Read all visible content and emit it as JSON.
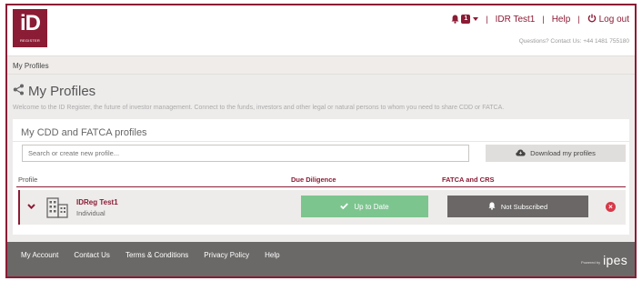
{
  "header": {
    "logo_text": "iD",
    "logo_sub": "REGISTER",
    "notification_count": "1",
    "user_name": "IDR Test1",
    "help_label": "Help",
    "logout_label": "Log out",
    "contact_text": "Questions? Contact Us: +44 1481 755180"
  },
  "breadcrumb": {
    "current": "My Profiles"
  },
  "page": {
    "title": "My Profiles",
    "welcome": "Welcome to the ID Register, the future of investor management. Connect to the funds, investors and other legal or natural persons to whom you need to share CDD or FATCA."
  },
  "profiles_card": {
    "title": "My CDD and FATCA profiles",
    "search_placeholder": "Search or create new profile...",
    "download_label": "Download my profiles",
    "columns": {
      "profile": "Profile",
      "due_diligence": "Due Diligence",
      "fatca_crs": "FATCA and CRS"
    },
    "rows": [
      {
        "name": "IDReg Test1",
        "type": "Individual",
        "due_diligence_status": "Up to Date",
        "fatca_status": "Not Subscribed"
      }
    ]
  },
  "footer": {
    "links": [
      "My Account",
      "Contact Us",
      "Terms & Conditions",
      "Privacy Policy",
      "Help"
    ],
    "powered_by": "Powered by",
    "brand": "ipes"
  },
  "colors": {
    "brand": "#8b1c35",
    "success": "#7dc58f",
    "neutral_button": "#6a6766",
    "danger": "#d63a4a",
    "footer_bg": "#6b6968"
  },
  "icons": [
    "bell-icon",
    "power-icon",
    "share-icon",
    "cloud-download-icon",
    "chevron-down-icon",
    "building-icon",
    "check-icon",
    "remove-icon",
    "ipes-logo"
  ]
}
